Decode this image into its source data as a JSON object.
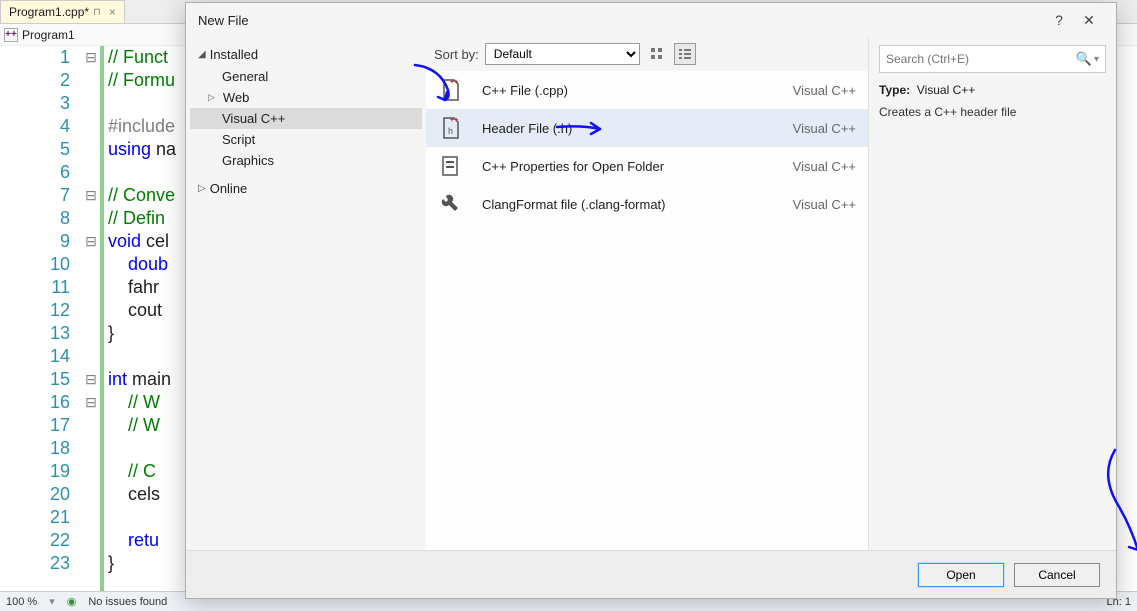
{
  "tab": {
    "label": "Program1.cpp*"
  },
  "breadcrumb": {
    "label": "Program1"
  },
  "line_numbers": [
    "1",
    "2",
    "3",
    "4",
    "5",
    "6",
    "7",
    "8",
    "9",
    "10",
    "11",
    "12",
    "13",
    "14",
    "15",
    "16",
    "17",
    "18",
    "19",
    "20",
    "21",
    "22",
    "23"
  ],
  "folds": [
    "⊟",
    "",
    "",
    "",
    "",
    "",
    "⊟",
    "",
    "⊟",
    "",
    "",
    "",
    "",
    "",
    "⊟",
    "⊟",
    "",
    "",
    "",
    "",
    "",
    "",
    ""
  ],
  "code": {
    "l1": "// Funct",
    "l2": "// Formu",
    "l4": "#include",
    "l5a": "using",
    "l5b": " na",
    "l7": "// Conve",
    "l8": "// Defin",
    "l9a": "void",
    "l9b": " cel",
    "l10a": "    ",
    "l10b": "doub",
    "l11": "    fahr",
    "l12": "    cout",
    "l13": "}",
    "l15a": "int",
    "l15b": " main",
    "l16": "    // W",
    "l17": "    // W",
    "l19": "    // C",
    "l20": "    cels",
    "l22a": "    ",
    "l22b": "retu",
    "l23": "}"
  },
  "statusbar": {
    "zoom": "100 %",
    "issues": "No issues found",
    "line": "Ln: 1"
  },
  "dialog": {
    "title": "New File",
    "categories": {
      "installed": "Installed",
      "items": [
        "General",
        "Web",
        "Visual C++",
        "Script",
        "Graphics"
      ],
      "online": "Online"
    },
    "sortby_label": "Sort by:",
    "sortby_value": "Default",
    "templates": [
      {
        "label": "C++ File (.cpp)",
        "lang": "Visual C++"
      },
      {
        "label": "Header File (.h)",
        "lang": "Visual C++"
      },
      {
        "label": "C++ Properties for Open Folder",
        "lang": "Visual C++"
      },
      {
        "label": "ClangFormat file (.clang-format)",
        "lang": "Visual C++"
      }
    ],
    "search_placeholder": "Search (Ctrl+E)",
    "details": {
      "type_label": "Type:",
      "type_value": "Visual C++",
      "description": "Creates a C++ header file"
    },
    "buttons": {
      "open": "Open",
      "cancel": "Cancel"
    }
  }
}
